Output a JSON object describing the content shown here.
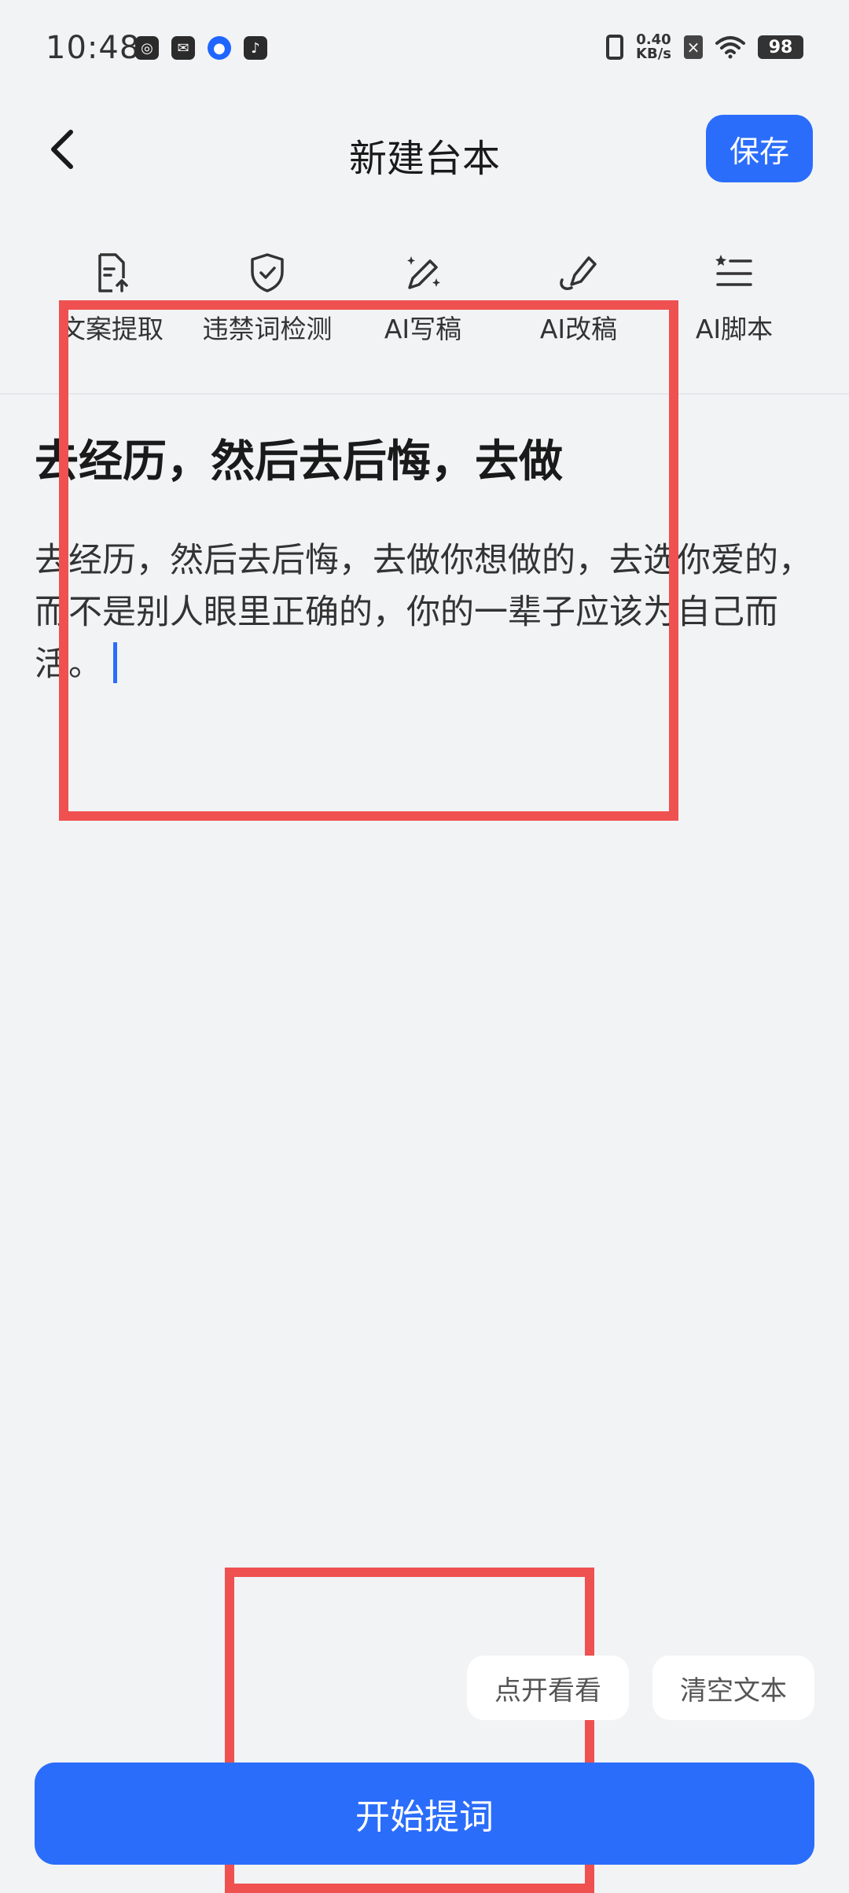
{
  "status_bar": {
    "time": "10:48",
    "app_icons": [
      "ring-app-icon",
      "mail-app-icon",
      "browser-app-icon",
      "tiktok-app-icon"
    ],
    "net_speed_value": "0.40",
    "net_speed_unit": "KB/s",
    "sim_glyph": "×",
    "battery": "98"
  },
  "header": {
    "title": "新建台本",
    "save_label": "保存"
  },
  "toolbar": {
    "items": [
      {
        "label": "文案提取",
        "icon": "document-upload-icon"
      },
      {
        "label": "违禁词检测",
        "icon": "shield-check-icon"
      },
      {
        "label": "AI写稿",
        "icon": "magic-pen-icon"
      },
      {
        "label": "AI改稿",
        "icon": "pen-edit-icon"
      },
      {
        "label": "AI脚本",
        "icon": "star-list-icon"
      }
    ]
  },
  "editor": {
    "title": "去经历，然后去后悔，去做",
    "body": "去经历，然后去后悔，去做你想做的，去选你爱的，而不是别人眼里正确的，你的一辈子应该为自己而活。"
  },
  "actions": {
    "preview_label": "点开看看",
    "clear_label": "清空文本",
    "start_label": "开始提词"
  },
  "colors": {
    "accent": "#2b6dfb",
    "highlight": "#ee5150",
    "background": "#f2f3f5"
  }
}
